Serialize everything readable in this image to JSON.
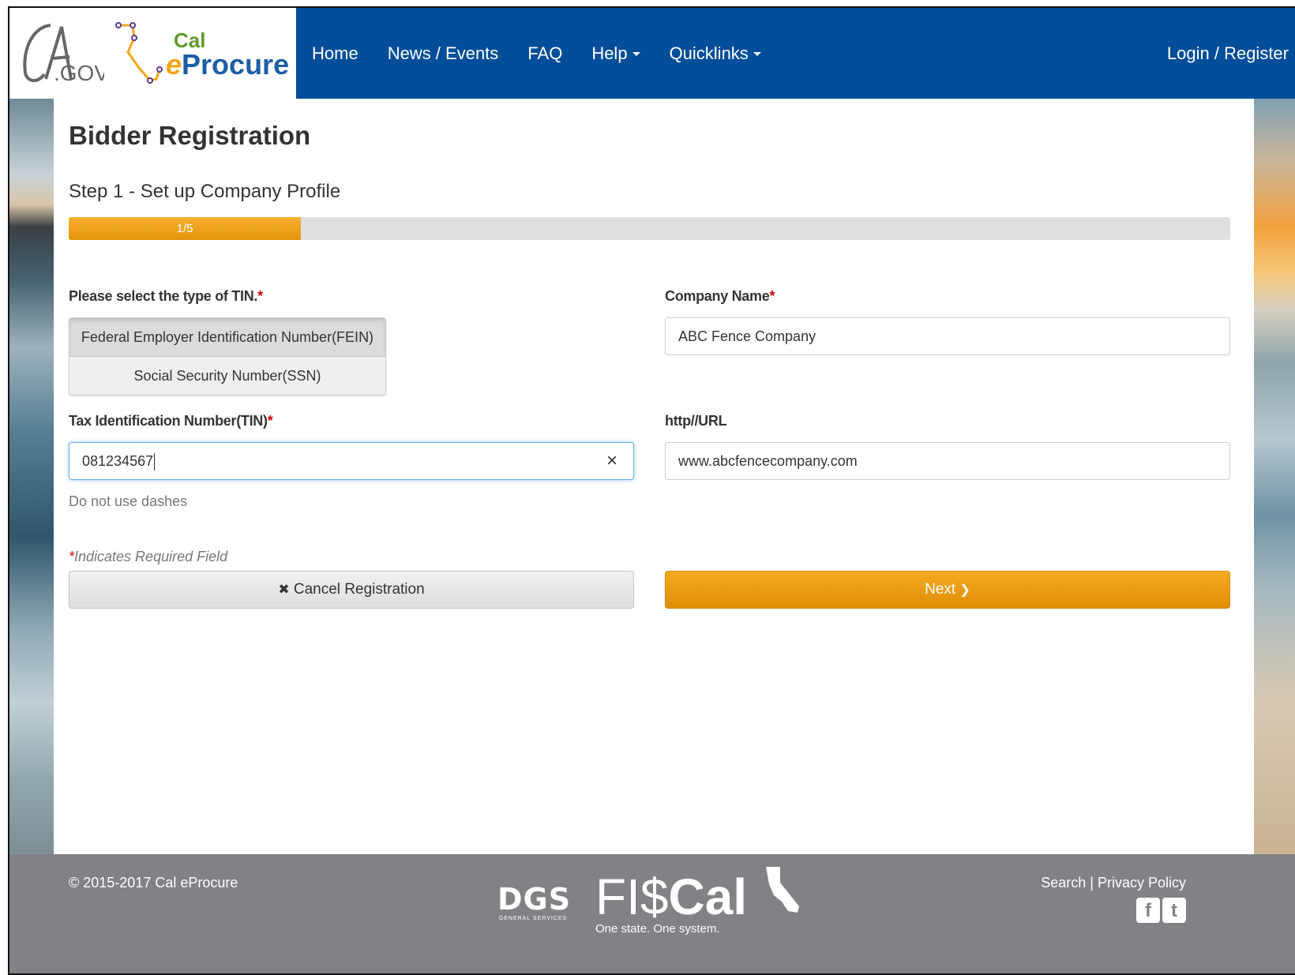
{
  "header": {
    "nav": [
      {
        "label": "Home"
      },
      {
        "label": "News / Events"
      },
      {
        "label": "FAQ"
      },
      {
        "label": "Help"
      },
      {
        "label": "Quicklinks"
      }
    ],
    "login_label": "Login / Register",
    "logo_ca": "CA.GOV",
    "logo_cal_top": "Cal",
    "logo_cal_bottom_e": "e",
    "logo_cal_bottom_rest": "Procure"
  },
  "page": {
    "title": "Bidder Registration",
    "step": "Step 1 - Set up Company Profile",
    "progress_label": "1/5",
    "progress_fraction": 0.2
  },
  "form": {
    "tin_type_label": "Please select the type of TIN.",
    "tin_type_options": [
      {
        "label": "Federal Employer Identification Number(FEIN)",
        "selected": true
      },
      {
        "label": "Social Security Number(SSN)",
        "selected": false
      }
    ],
    "tin_label": "Tax Identification Number(TIN)",
    "tin_value": "081234567",
    "tin_help": "Do not use dashes",
    "company_label": "Company Name",
    "company_value": "ABC Fence Company",
    "url_label": "http//URL",
    "url_value": "www.abcfencecompany.com",
    "required_marker": "*",
    "required_note": "Indicates Required Field",
    "clear_glyph": "×"
  },
  "buttons": {
    "cancel": "Cancel Registration",
    "cancel_icon": "✖",
    "next": "Next",
    "next_icon": "❯"
  },
  "footer": {
    "copyright": "© 2015-2017 Cal eProcure",
    "dgs_big": "DGS",
    "dgs_small": "GENERAL SERVICES",
    "fiscal_light": "FI$",
    "fiscal_bold": "Cal",
    "fiscal_tagline": "One state. One system.",
    "link_search": "Search",
    "link_separator": " | ",
    "link_privacy": "Privacy Policy",
    "facebook_glyph": "f",
    "twitter_glyph": "t"
  },
  "colors": {
    "header_blue": "#004d99",
    "accent_orange": "#f2a51a",
    "footer_gray": "#808285",
    "required_red": "#d40000"
  }
}
